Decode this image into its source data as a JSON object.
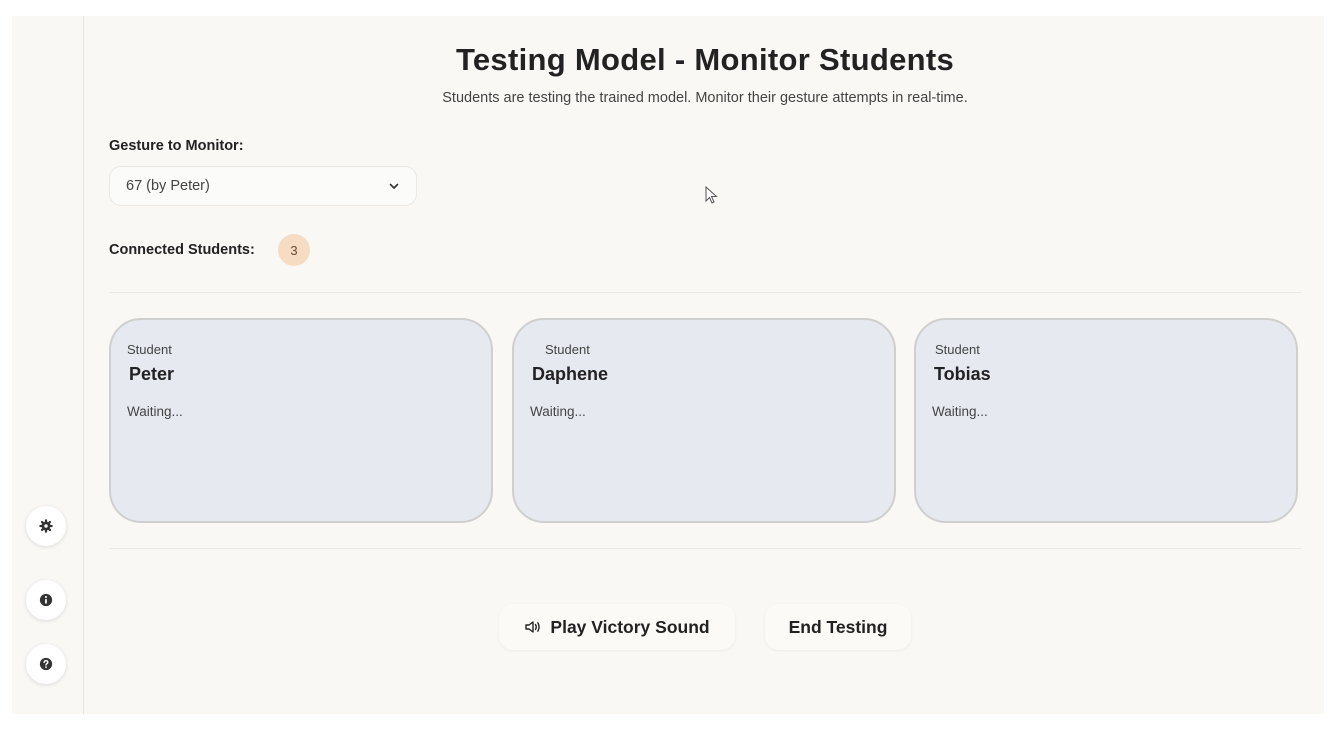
{
  "header": {
    "title": "Testing Model - Monitor Students",
    "subtitle": "Students are testing the trained model. Monitor their gesture attempts in real-time."
  },
  "gesture": {
    "label": "Gesture to Monitor:",
    "selected": "67 (by Peter)"
  },
  "connected": {
    "label": "Connected Students:",
    "count": "3"
  },
  "students": [
    {
      "label": "Student",
      "name": "Peter",
      "status": "Waiting..."
    },
    {
      "label": "Student",
      "name": "Daphene",
      "status": "Waiting..."
    },
    {
      "label": "Student",
      "name": "Tobias",
      "status": "Waiting..."
    }
  ],
  "actions": {
    "victory": {
      "label": "Play Victory Sound",
      "icon": "speaker-icon"
    },
    "end": {
      "label": "End Testing"
    }
  },
  "sidebar": {
    "icons": [
      "gear-icon",
      "info-icon",
      "help-icon"
    ]
  },
  "colors": {
    "background": "#f9f8f5",
    "card": "#e6e9f0",
    "badge": "#f7dcc4"
  }
}
